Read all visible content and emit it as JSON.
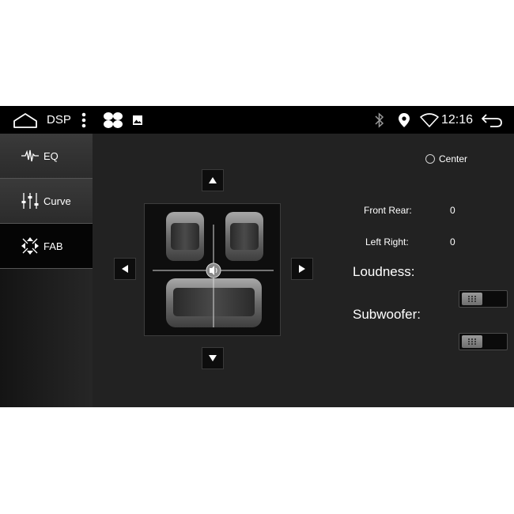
{
  "statusbar": {
    "title": "DSP",
    "time": "12:16",
    "icons": [
      "home-icon",
      "more-vert-icon",
      "apps-icon",
      "gallery-icon",
      "bluetooth-icon",
      "location-icon",
      "wifi-icon",
      "back-icon"
    ]
  },
  "sidebar": {
    "items": [
      {
        "label": "EQ",
        "icon": "eq-waveform-icon"
      },
      {
        "label": "Curve",
        "icon": "curve-sliders-icon"
      },
      {
        "label": "FAB",
        "icon": "fab-arrows-icon",
        "selected": true
      }
    ]
  },
  "balance": {
    "center_label": "Center",
    "front_rear_label": "Front Rear:",
    "front_rear_value": "0",
    "left_right_label": "Left Right:",
    "left_right_value": "0"
  },
  "switches": {
    "loudness_label": "Loudness:",
    "subwoofer_label": "Subwoofer:"
  },
  "colors": {
    "background": "#222222",
    "statusbar": "#000000",
    "selected_tab": "#050505",
    "text": "#ffffff"
  }
}
